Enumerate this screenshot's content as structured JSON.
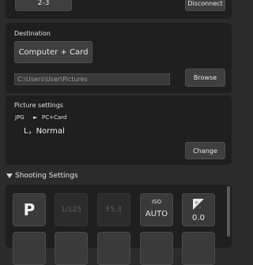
{
  "top": {
    "value_button": "2-3",
    "disconnect_label": "Disconnect"
  },
  "destination": {
    "heading": "Destination",
    "selected_option": "Computer + Card",
    "path": "C:\\Users\\User\\Pictures",
    "browse_label": "Browse"
  },
  "picture_settings": {
    "heading": "Picture settings",
    "format": "JPG",
    "arrow": "►",
    "target": "PC+Card",
    "quality": "L，Normal",
    "change_label": "Change"
  },
  "shooting_settings": {
    "heading": "Shooting Settings",
    "mode": "P",
    "shutter": "1/125",
    "aperture": "F5.3",
    "iso_label": "ISO",
    "iso_value": "AUTO",
    "exposure_value": "0.0"
  }
}
